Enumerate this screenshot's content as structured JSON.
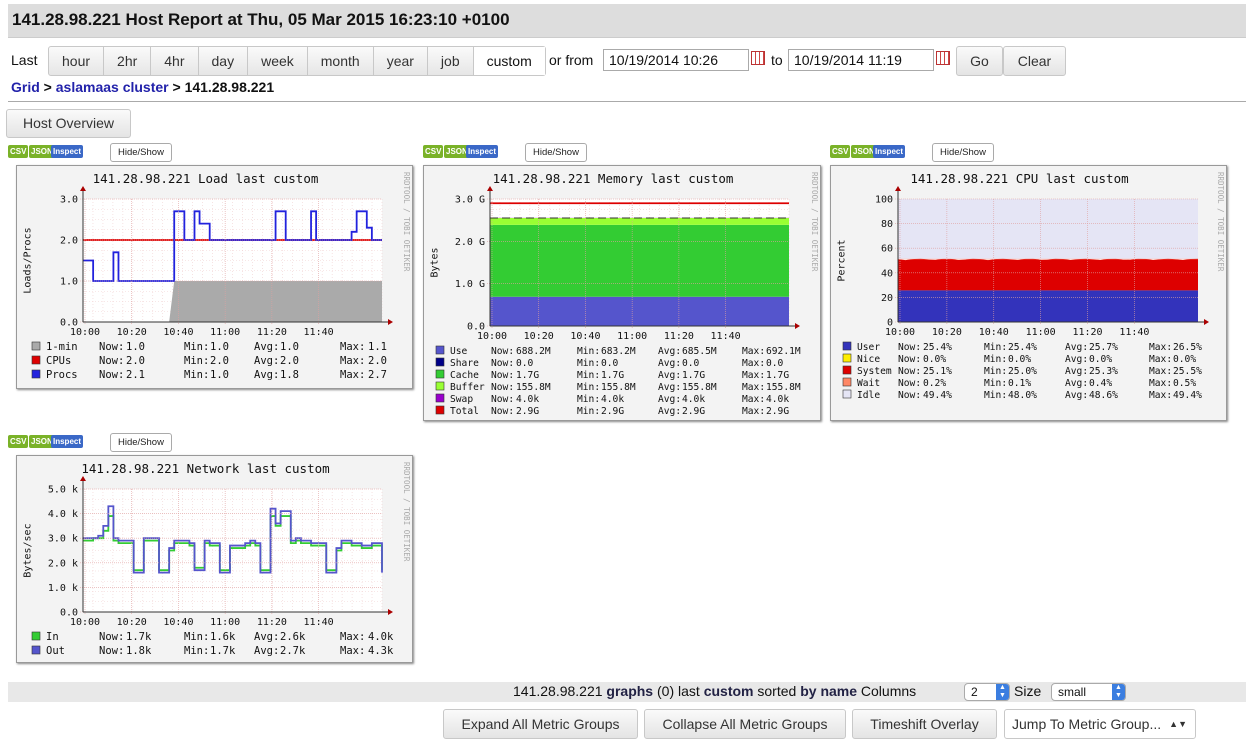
{
  "header": {
    "title": "141.28.98.221 Host Report at Thu, 05 Mar 2015 16:23:10 +0100"
  },
  "range": {
    "last_label": "Last",
    "buttons": [
      "hour",
      "2hr",
      "4hr",
      "day",
      "week",
      "month",
      "year",
      "job",
      "custom"
    ],
    "selected": "custom",
    "or_from": "or from",
    "from_value": "10/19/2014 10:26",
    "to_label": "to",
    "to_value": "10/19/2014 11:19",
    "go": "Go",
    "clear": "Clear"
  },
  "breadcrumb": {
    "grid": "Grid",
    "sep1": " > ",
    "cluster": "aslamaas cluster",
    "sep2": " > ",
    "host": "141.28.98.221"
  },
  "host_overview": "Host Overview",
  "panel_buttons": {
    "csv": "CSV",
    "json": "JSON",
    "inspect": "Inspect",
    "events": "Hide/Show Events"
  },
  "watermark": "RRDTOOL / TOBI OETIKER",
  "colors": {
    "accent_link": "#2222aa",
    "red": "#dd0000",
    "blue": "#2222dd",
    "gray": "#aaaaaa",
    "green": "#33cc33",
    "purple": "#6666cc"
  },
  "chart_data": [
    {
      "type": "line",
      "title": "141.28.98.221 Load last custom",
      "ylabel": "Loads/Procs",
      "ylim": [
        0,
        3
      ],
      "yticks": [
        "3.0",
        "2.0",
        "1.0",
        "0.0"
      ],
      "xticks": [
        "10:00",
        "10:20",
        "10:40",
        "11:00",
        "11:20",
        "11:40"
      ],
      "series": [
        {
          "name": "1-min",
          "kind": "area",
          "color": "#aaaaaa",
          "values": [
            0,
            0,
            0,
            0,
            0,
            0,
            0,
            0,
            0,
            0,
            0,
            0,
            0,
            0,
            0,
            0,
            0,
            0,
            1.0,
            1.0,
            1.0,
            1.0,
            1.0,
            1.0,
            1.0,
            1.0,
            1.0,
            1.0,
            1.0,
            1.0,
            1.0,
            1.0,
            1.0,
            1.0,
            1.0,
            1.0,
            1.0,
            1.0,
            1.0,
            1.0,
            1.0,
            1.0,
            1.0,
            1.0,
            1.0,
            1.0,
            1.0,
            1.0,
            1.0,
            1.0,
            1.0,
            1.0,
            1.0,
            1.0,
            1.0,
            1.0,
            1.0,
            1.0,
            1.0,
            1.0
          ]
        },
        {
          "name": "CPUs",
          "kind": "line",
          "color": "#dd0000",
          "values": [
            2,
            2,
            2,
            2,
            2,
            2,
            2,
            2,
            2,
            2,
            2,
            2,
            2,
            2,
            2,
            2,
            2,
            2,
            2,
            2,
            2,
            2,
            2,
            2,
            2,
            2,
            2,
            2,
            2,
            2,
            2,
            2,
            2,
            2,
            2,
            2,
            2,
            2,
            2,
            2,
            2,
            2,
            2,
            2,
            2,
            2,
            2,
            2,
            2,
            2,
            2,
            2,
            2,
            2,
            2,
            2,
            2,
            2,
            2,
            2
          ]
        },
        {
          "name": "Procs",
          "kind": "line",
          "color": "#2222dd",
          "values": [
            1.5,
            1.5,
            1.0,
            1.0,
            1.0,
            1.0,
            1.7,
            1.0,
            1.0,
            1.0,
            1.0,
            1.0,
            1.0,
            1.0,
            1.0,
            1.0,
            1.0,
            1.0,
            2.7,
            2.7,
            2.0,
            2.0,
            2.7,
            2.4,
            2.4,
            2.0,
            2.0,
            2.0,
            2.0,
            2.0,
            2.0,
            2.0,
            2.0,
            2.0,
            2.0,
            2.0,
            2.0,
            2.0,
            2.7,
            2.7,
            2.0,
            2.0,
            2.0,
            2.0,
            2.0,
            2.7,
            2.0,
            2.0,
            2.0,
            2.0,
            2.0,
            2.0,
            2.0,
            2.2,
            2.7,
            2.7,
            2.3,
            2.0,
            2.0,
            2.0
          ]
        }
      ],
      "legend": [
        {
          "name": "1-min",
          "color": "#aaaaaa",
          "now": "1.0",
          "min": "1.0",
          "avg": "1.0",
          "max": "1.1"
        },
        {
          "name": "CPUs",
          "color": "#dd0000",
          "now": "2.0",
          "min": "2.0",
          "avg": "2.0",
          "max": "2.0"
        },
        {
          "name": "Procs",
          "color": "#2222dd",
          "now": "2.1",
          "min": "1.0",
          "avg": "1.8",
          "max": "2.7"
        }
      ]
    },
    {
      "type": "area",
      "title": "141.28.98.221 Memory last custom",
      "ylabel": "Bytes",
      "ylim": [
        0,
        3.0
      ],
      "yticks": [
        "3.0 G",
        "2.0 G",
        "1.0 G",
        "0.0"
      ],
      "xticks": [
        "10:00",
        "10:20",
        "10:40",
        "11:00",
        "11:20",
        "11:40"
      ],
      "series": [
        {
          "name": "Use",
          "color": "#5555cc",
          "value": 0.69
        },
        {
          "name": "Share",
          "color": "#000088",
          "value": 0.0
        },
        {
          "name": "Cache",
          "color": "#33cc33",
          "value": 1.7
        },
        {
          "name": "Buffer",
          "color": "#99ff33",
          "value": 0.16
        },
        {
          "name": "Swap",
          "color": "#9900cc",
          "value": 0.004
        },
        {
          "name": "Total",
          "color": "#dd0000",
          "value": 2.9
        }
      ],
      "legend": [
        {
          "name": "Use",
          "color": "#5555cc",
          "now": "688.2M",
          "min": "683.2M",
          "avg": "685.5M",
          "max": "692.1M"
        },
        {
          "name": "Share",
          "color": "#000088",
          "now": "0.0",
          "min": "0.0",
          "avg": "0.0",
          "max": "0.0"
        },
        {
          "name": "Cache",
          "color": "#33cc33",
          "now": "1.7G",
          "min": "1.7G",
          "avg": "1.7G",
          "max": "1.7G"
        },
        {
          "name": "Buffer",
          "color": "#99ff33",
          "now": "155.8M",
          "min": "155.8M",
          "avg": "155.8M",
          "max": "155.8M"
        },
        {
          "name": "Swap",
          "color": "#9900cc",
          "now": "4.0k",
          "min": "4.0k",
          "avg": "4.0k",
          "max": "4.0k"
        },
        {
          "name": "Total",
          "color": "#dd0000",
          "now": "2.9G",
          "min": "2.9G",
          "avg": "2.9G",
          "max": "2.9G"
        }
      ]
    },
    {
      "type": "area",
      "title": "141.28.98.221 CPU last custom",
      "ylabel": "Percent",
      "ylim": [
        0,
        100
      ],
      "yticks": [
        "100",
        "80",
        "60",
        "40",
        "20",
        "0"
      ],
      "xticks": [
        "10:00",
        "10:20",
        "10:40",
        "11:00",
        "11:20",
        "11:40"
      ],
      "series": [
        {
          "name": "User",
          "color": "#3333bb",
          "value": 25.7
        },
        {
          "name": "Nice",
          "color": "#ffee00",
          "value": 0.0
        },
        {
          "name": "System",
          "color": "#dd0000",
          "value": 25.3
        },
        {
          "name": "Wait",
          "color": "#ff8866",
          "value": 0.4
        },
        {
          "name": "Idle",
          "color": "#e5e5f5",
          "value": 48.6
        }
      ],
      "legend": [
        {
          "name": "User",
          "color": "#3333bb",
          "now": "25.4%",
          "min": "25.4%",
          "avg": "25.7%",
          "max": "26.5%"
        },
        {
          "name": "Nice",
          "color": "#ffee00",
          "now": "0.0%",
          "min": "0.0%",
          "avg": "0.0%",
          "max": "0.0%"
        },
        {
          "name": "System",
          "color": "#dd0000",
          "now": "25.1%",
          "min": "25.0%",
          "avg": "25.3%",
          "max": "25.5%"
        },
        {
          "name": "Wait",
          "color": "#ff8866",
          "now": "0.2%",
          "min": "0.1%",
          "avg": "0.4%",
          "max": "0.5%"
        },
        {
          "name": "Idle",
          "color": "#e5e5f5",
          "now": "49.4%",
          "min": "48.0%",
          "avg": "48.6%",
          "max": "49.4%"
        }
      ]
    },
    {
      "type": "line",
      "title": "141.28.98.221 Network last custom",
      "ylabel": "Bytes/sec",
      "ylim": [
        0,
        5000
      ],
      "yticks": [
        "5.0 k",
        "4.0 k",
        "3.0 k",
        "2.0 k",
        "1.0 k",
        "0.0"
      ],
      "xticks": [
        "10:00",
        "10:20",
        "10:40",
        "11:00",
        "11:20",
        "11:40"
      ],
      "series": [
        {
          "name": "In",
          "color": "#33cc33",
          "values": [
            2900,
            2900,
            3000,
            3000,
            3300,
            3900,
            2900,
            2800,
            2800,
            2800,
            1700,
            1700,
            2900,
            2900,
            2900,
            1700,
            1700,
            2500,
            2800,
            2800,
            2800,
            2700,
            1800,
            1800,
            2800,
            2700,
            2700,
            1700,
            1700,
            2600,
            2600,
            2600,
            2700,
            2800,
            2700,
            1700,
            1700,
            3900,
            3500,
            3900,
            3900,
            2800,
            2900,
            2800,
            2800,
            2700,
            2700,
            2700,
            1700,
            1700,
            2500,
            2800,
            2800,
            2700,
            2700,
            2600,
            2600,
            2700,
            2700,
            1700
          ]
        },
        {
          "name": "Out",
          "color": "#5555cc",
          "values": [
            3000,
            3000,
            3000,
            3100,
            3500,
            4300,
            3000,
            2900,
            2900,
            2900,
            1600,
            1600,
            3000,
            3000,
            3000,
            1600,
            1600,
            2600,
            2900,
            2900,
            2900,
            2800,
            1700,
            1700,
            2900,
            2800,
            2800,
            1600,
            1600,
            2700,
            2700,
            2700,
            2800,
            2900,
            2800,
            1600,
            1600,
            4200,
            3600,
            4100,
            4100,
            2900,
            3000,
            2900,
            2900,
            2800,
            2800,
            2800,
            1600,
            1600,
            2600,
            2900,
            2900,
            2800,
            2800,
            2700,
            2700,
            2800,
            2800,
            1600
          ]
        }
      ],
      "legend": [
        {
          "name": "In",
          "color": "#33cc33",
          "now": "1.7k",
          "min": "1.6k",
          "avg": "2.6k",
          "max": "4.0k"
        },
        {
          "name": "Out",
          "color": "#5555cc",
          "now": "1.8k",
          "min": "1.7k",
          "avg": "2.7k",
          "max": "4.3k"
        }
      ]
    }
  ],
  "footer": {
    "host": "141.28.98.221",
    "graphs": "graphs",
    "count": "(0)",
    "last": "last",
    "range": "custom",
    "sorted": "sorted",
    "by": "by",
    "name": "name",
    "columns_label": "Columns",
    "columns_value": "2",
    "size_label": "Size",
    "size_value": "small",
    "expand": "Expand All Metric Groups",
    "collapse": "Collapse All Metric Groups",
    "timeshift": "Timeshift Overlay",
    "jump": "Jump To Metric Group..."
  }
}
